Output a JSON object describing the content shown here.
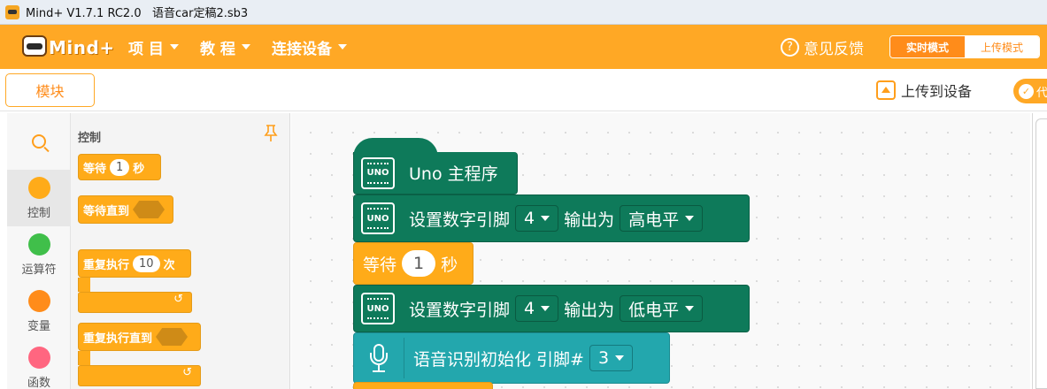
{
  "window": {
    "title": "Mind+ V1.7.1 RC2.0   语音car定稿2.sb3"
  },
  "menubar": {
    "logo_text": "Mind+",
    "menus": [
      {
        "label": "项 目"
      },
      {
        "label": "教 程"
      },
      {
        "label": "连接设备"
      }
    ],
    "feedback_label": "意见反馈",
    "mode_realtime": "实时模式",
    "mode_upload": "上传模式"
  },
  "toolbar": {
    "blocks_tab": "模块",
    "upload_label": "上传到设备",
    "code_label": "代"
  },
  "categories": [
    {
      "label": "控制",
      "color": "#ffab19",
      "selected": true
    },
    {
      "label": "运算符",
      "color": "#40bf4a",
      "selected": false
    },
    {
      "label": "变量",
      "color": "#ff8c1a",
      "selected": false
    },
    {
      "label": "函数",
      "color": "#ff6680",
      "selected": false
    }
  ],
  "flyout": {
    "section_label": "控制",
    "wait_block": {
      "prefix": "等待",
      "value": "1",
      "suffix": "秒"
    },
    "wait_until_block": {
      "label": "等待直到"
    },
    "repeat_block": {
      "prefix": "重复执行",
      "value": "10",
      "suffix": "次",
      "arrow": "↺"
    },
    "repeat_until_block": {
      "label": "重复执行直到",
      "arrow": "↺"
    }
  },
  "script": {
    "main_block": {
      "board": "UNO",
      "label": "Uno 主程序"
    },
    "set_pin_1": {
      "prefix": "设置数字引脚",
      "pin": "4",
      "mid": "输出为",
      "level": "高电平"
    },
    "wait": {
      "prefix": "等待",
      "value": "1",
      "suffix": "秒"
    },
    "set_pin_2": {
      "prefix": "设置数字引脚",
      "pin": "4",
      "mid": "输出为",
      "level": "低电平"
    },
    "voice_init": {
      "label": "语音识别初始化 引脚#",
      "pin": "3"
    }
  },
  "colors": {
    "brand_orange": "#ffa825",
    "block_green": "#0e7a5a",
    "block_teal": "#23a7ad",
    "control_orange": "#ffab19"
  }
}
